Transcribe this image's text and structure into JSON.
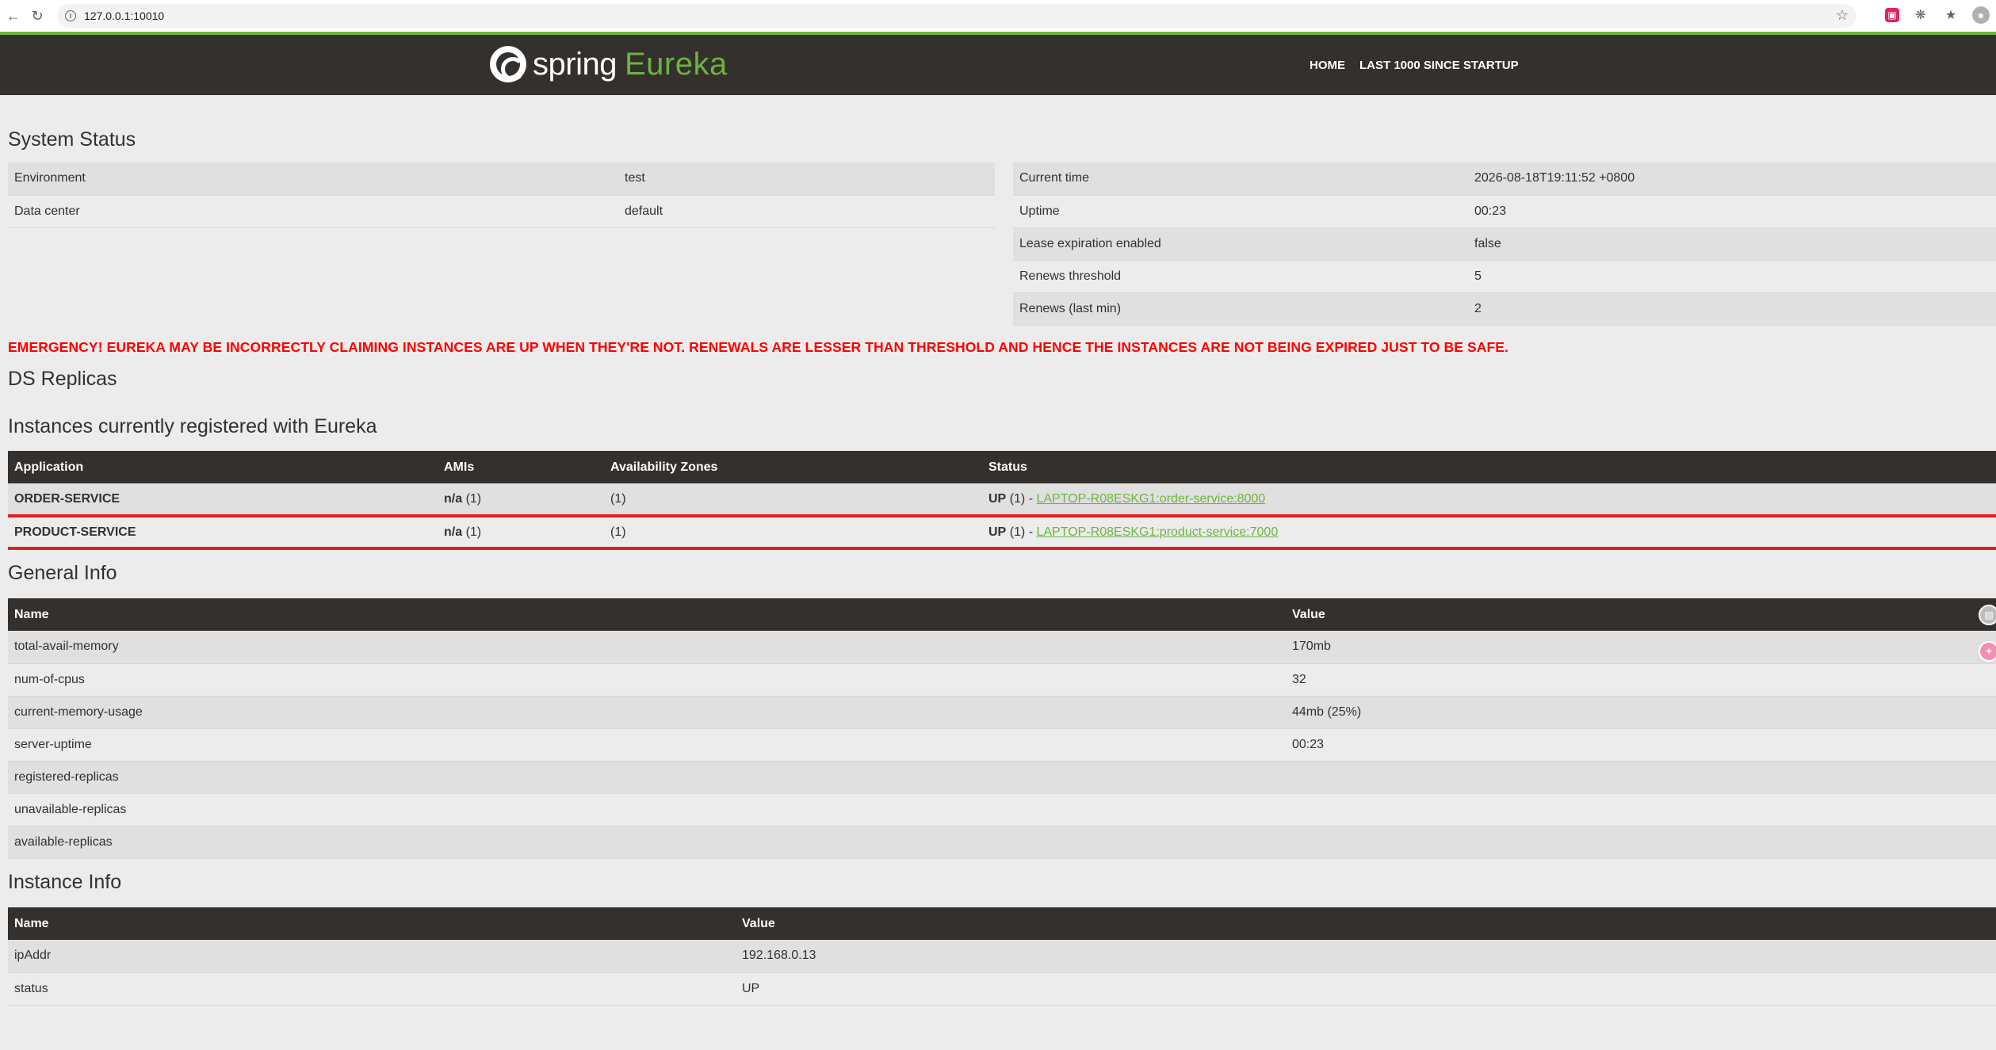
{
  "browser": {
    "url": "127.0.0.1:10010"
  },
  "navbar": {
    "brand_spring": "spring",
    "brand_eureka": "Eureka",
    "links": [
      "HOME",
      "LAST 1000 SINCE STARTUP"
    ]
  },
  "system_status": {
    "title": "System Status",
    "left": [
      {
        "name": "Environment",
        "value": "test"
      },
      {
        "name": "Data center",
        "value": "default"
      }
    ],
    "right": [
      {
        "name": "Current time",
        "value": "2026-08-18T19:11:52 +0800"
      },
      {
        "name": "Uptime",
        "value": "00:23"
      },
      {
        "name": "Lease expiration enabled",
        "value": "false"
      },
      {
        "name": "Renews threshold",
        "value": "5"
      },
      {
        "name": "Renews (last min)",
        "value": "2"
      }
    ]
  },
  "emergency": "EMERGENCY! EUREKA MAY BE INCORRECTLY CLAIMING INSTANCES ARE UP WHEN THEY'RE NOT. RENEWALS ARE LESSER THAN THRESHOLD AND HENCE THE INSTANCES ARE NOT BEING EXPIRED JUST TO BE SAFE.",
  "ds_replicas_title": "DS Replicas",
  "instances": {
    "title": "Instances currently registered with Eureka",
    "headers": [
      "Application",
      "AMIs",
      "Availability Zones",
      "Status"
    ],
    "rows": [
      {
        "app": "ORDER-SERVICE",
        "ami_bold": "n/a",
        "ami_count": "(1)",
        "zones": "(1)",
        "status_bold": "UP",
        "status_count": "(1) - ",
        "link": "LAPTOP-R08ESKG1:order-service:8000"
      },
      {
        "app": "PRODUCT-SERVICE",
        "ami_bold": "n/a",
        "ami_count": "(1)",
        "zones": "(1)",
        "status_bold": "UP",
        "status_count": "(1) - ",
        "link": "LAPTOP-R08ESKG1:product-service:7000"
      }
    ]
  },
  "general_info": {
    "title": "General Info",
    "headers": [
      "Name",
      "Value"
    ],
    "rows": [
      {
        "name": "total-avail-memory",
        "value": "170mb"
      },
      {
        "name": "num-of-cpus",
        "value": "32"
      },
      {
        "name": "current-memory-usage",
        "value": "44mb (25%)"
      },
      {
        "name": "server-uptime",
        "value": "00:23"
      },
      {
        "name": "registered-replicas",
        "value": ""
      },
      {
        "name": "unavailable-replicas",
        "value": ""
      },
      {
        "name": "available-replicas",
        "value": ""
      }
    ]
  },
  "instance_info": {
    "title": "Instance Info",
    "headers": [
      "Name",
      "Value"
    ],
    "rows": [
      {
        "name": "ipAddr",
        "value": "192.168.0.13"
      },
      {
        "name": "status",
        "value": "UP"
      }
    ]
  },
  "colors": {
    "spring_green": "#6db33f",
    "navbar_dark": "#34302d",
    "emergency_red": "#ff0000"
  }
}
